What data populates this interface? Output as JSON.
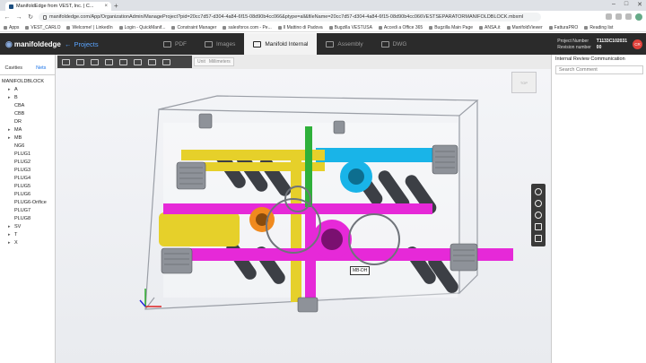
{
  "browser": {
    "tab_title": "ManifoldEdge from VEST, Inc. | C...",
    "url": "manifoldedge.com/App/OrganizationAdmin/ManageProject?pid=20cc7d57-d304-4a84-6f15-08d90b4cc066&ptype=all&fileName=20cc7d57-d304-4a84-6f15-08d90b4cc066VESTSEPARATORMANIFOLDBLOCK.mbxml",
    "bookmarks": [
      "Apps",
      "VEST_CARLO",
      "Welcome! | LinkedIn",
      "Login - QuickManif...",
      "Constraint Manager",
      "salesforce.com - Pe...",
      "Il Mattino di Padova",
      "Bugzilla VESTUSA",
      "Accedi a Office 365",
      "Bugzilla Main Page",
      "ANSA.it",
      "ManifoldViewer",
      "FatturaPRO",
      "Reading list"
    ]
  },
  "app": {
    "logo_text": "manifoldedge",
    "projects_label": "Projects",
    "tabs": [
      {
        "label": "PDF",
        "active": false
      },
      {
        "label": "Images",
        "active": false
      },
      {
        "label": "Manifold Internal",
        "active": true
      },
      {
        "label": "Assembly",
        "active": false
      },
      {
        "label": "DWG",
        "active": false
      }
    ],
    "project_number_label": "Project Number",
    "project_number": "T1133C102031",
    "revision_label": "Revision number",
    "revision": "00",
    "user_initials": "CR"
  },
  "left_panel": {
    "tabs": [
      "Cavities",
      "Nets"
    ],
    "active_tab": "Nets",
    "root": "MANIFOLDBLOCK",
    "nodes": [
      "A",
      "B",
      "CBA",
      "CBB",
      "DR",
      "MA",
      "MB",
      "NG6",
      "PLUG1",
      "PLUG2",
      "PLUG3",
      "PLUG4",
      "PLUG5",
      "PLUG6",
      "PLUG6-Orifice",
      "PLUG7",
      "PLUG8",
      "SV",
      "T",
      "X"
    ],
    "expandable": [
      true,
      true,
      false,
      false,
      false,
      true,
      true,
      false,
      false,
      false,
      false,
      false,
      false,
      false,
      false,
      false,
      false,
      true,
      true,
      true
    ]
  },
  "toolbar": {
    "unit_label": "Unit",
    "unit_value": "Millimeters"
  },
  "viewport": {
    "viewcube_label": "TOP",
    "tooltip": "MB-DH"
  },
  "right_panel": {
    "title": "Internal Review Communication",
    "comment_placeholder": "Search Comment"
  }
}
